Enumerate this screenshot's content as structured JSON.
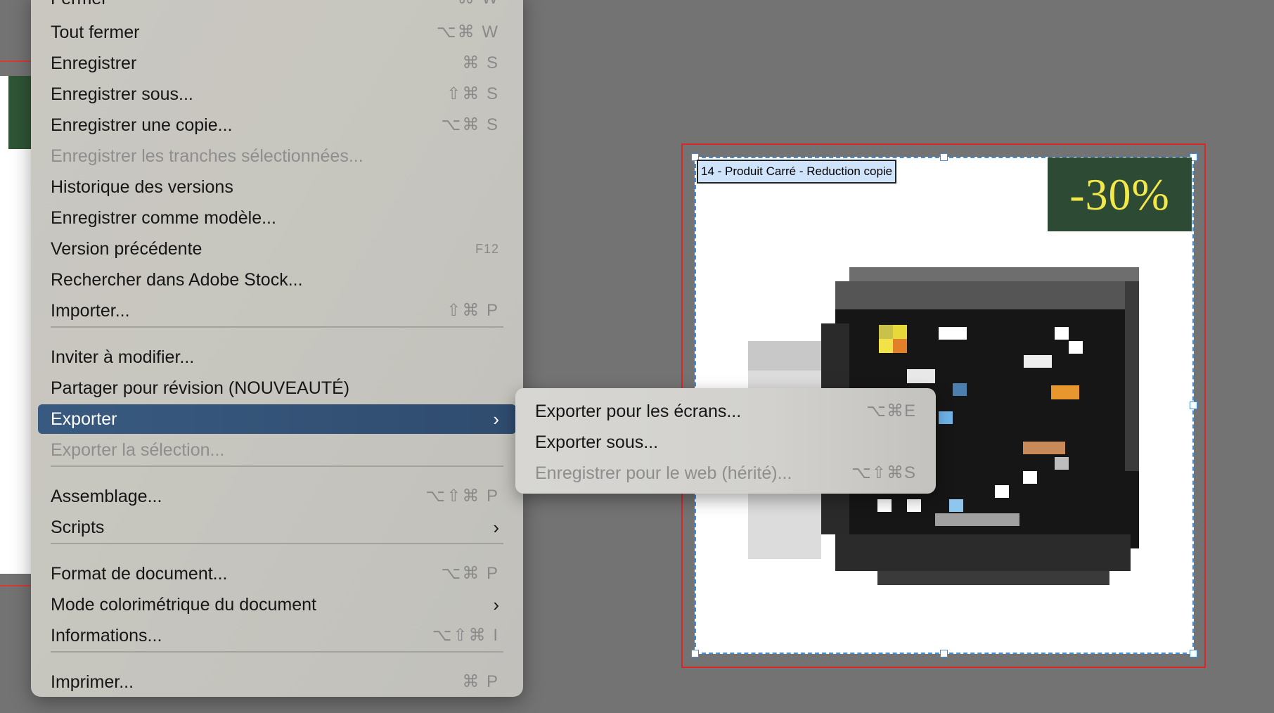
{
  "file_menu": {
    "items": [
      {
        "label": "Fermer",
        "shortcut": "⌘ W",
        "disabled": false,
        "partial": true
      },
      {
        "label": "Tout fermer",
        "shortcut": "⌥⌘ W",
        "disabled": false
      },
      {
        "label": "Enregistrer",
        "shortcut": "⌘ S",
        "disabled": false
      },
      {
        "label": "Enregistrer sous...",
        "shortcut": "⇧⌘ S",
        "disabled": false
      },
      {
        "label": "Enregistrer une copie...",
        "shortcut": "⌥⌘ S",
        "disabled": false
      },
      {
        "label": "Enregistrer les tranches sélectionnées...",
        "shortcut": "",
        "disabled": true
      },
      {
        "label": "Historique des versions",
        "shortcut": "",
        "disabled": false
      },
      {
        "label": "Enregistrer comme modèle...",
        "shortcut": "",
        "disabled": false
      },
      {
        "label": "Version précédente",
        "shortcut": "F12",
        "disabled": false
      },
      {
        "label": "Rechercher dans Adobe Stock...",
        "shortcut": "",
        "disabled": false
      },
      {
        "label": "Importer...",
        "shortcut": "⇧⌘ P",
        "disabled": false
      },
      {
        "label": "Inviter à modifier...",
        "shortcut": "",
        "disabled": false
      },
      {
        "label": "Partager pour révision (NOUVEAUTÉ)",
        "shortcut": "",
        "disabled": false
      },
      {
        "label": "Exporter",
        "shortcut": "",
        "disabled": false,
        "submenu": true,
        "highlighted": true
      },
      {
        "label": "Exporter la sélection...",
        "shortcut": "",
        "disabled": true
      },
      {
        "label": "Assemblage...",
        "shortcut": "⌥⇧⌘ P",
        "disabled": false
      },
      {
        "label": "Scripts",
        "shortcut": "",
        "disabled": false,
        "submenu": true
      },
      {
        "label": "Format de document...",
        "shortcut": "⌥⌘ P",
        "disabled": false
      },
      {
        "label": "Mode colorimétrique du document",
        "shortcut": "",
        "disabled": false,
        "submenu": true
      },
      {
        "label": "Informations...",
        "shortcut": "⌥⇧⌘ I",
        "disabled": false
      },
      {
        "label": "Imprimer...",
        "shortcut": "⌘ P",
        "disabled": false
      }
    ],
    "submenu_chevron": "›"
  },
  "export_submenu": {
    "items": [
      {
        "label": "Exporter pour les écrans...",
        "shortcut": "⌥⌘E",
        "disabled": false
      },
      {
        "label": "Exporter sous...",
        "shortcut": "",
        "disabled": false
      },
      {
        "label": "Enregistrer pour le web (hérité)...",
        "shortcut": "⌥⇧⌘S",
        "disabled": true
      }
    ]
  },
  "canvas": {
    "artboard_label": "14 - Produit Carré - Reduction copie",
    "discount_badge": "-30%",
    "colors": {
      "badge_bg": "#2d4a34",
      "badge_text": "#f2e84a",
      "bleed": "#d8262b",
      "selection": "#3b8fe0",
      "highlight": "#2f4c6f"
    }
  }
}
